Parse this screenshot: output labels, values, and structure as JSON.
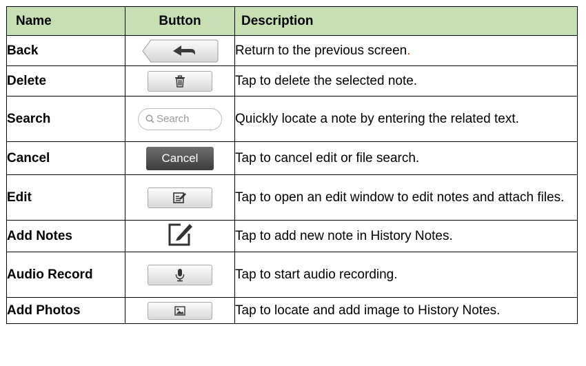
{
  "headers": {
    "name": "Name",
    "button": "Button",
    "description": "Description"
  },
  "rows": [
    {
      "name": "Back",
      "icon": "back-arrow-icon",
      "description": "Return to the previous screen",
      "description_suffix": "."
    },
    {
      "name": "Delete",
      "icon": "trash-icon",
      "description": "Tap to delete the selected note."
    },
    {
      "name": "Search",
      "icon": "search-icon",
      "button_text": "Search",
      "description": "Quickly locate a note by entering the related text."
    },
    {
      "name": "Cancel",
      "icon": "cancel-button",
      "button_text": "Cancel",
      "description": "Tap to cancel edit or file search."
    },
    {
      "name": "Edit",
      "icon": "edit-icon",
      "description": "Tap to open an edit window to edit notes and attach files."
    },
    {
      "name": "Add Notes",
      "icon": "pencil-square-icon",
      "description": "Tap to add new note in History Notes."
    },
    {
      "name": "Audio Record",
      "icon": "microphone-icon",
      "description": "Tap to start audio recording."
    },
    {
      "name": "Add Photos",
      "icon": "image-icon",
      "description": "Tap to locate and add image to History Notes."
    }
  ],
  "colors": {
    "header_bg": "#c6dfb3",
    "accent_red": "#e0321e",
    "cancel_bg": "#4a4a4a"
  }
}
